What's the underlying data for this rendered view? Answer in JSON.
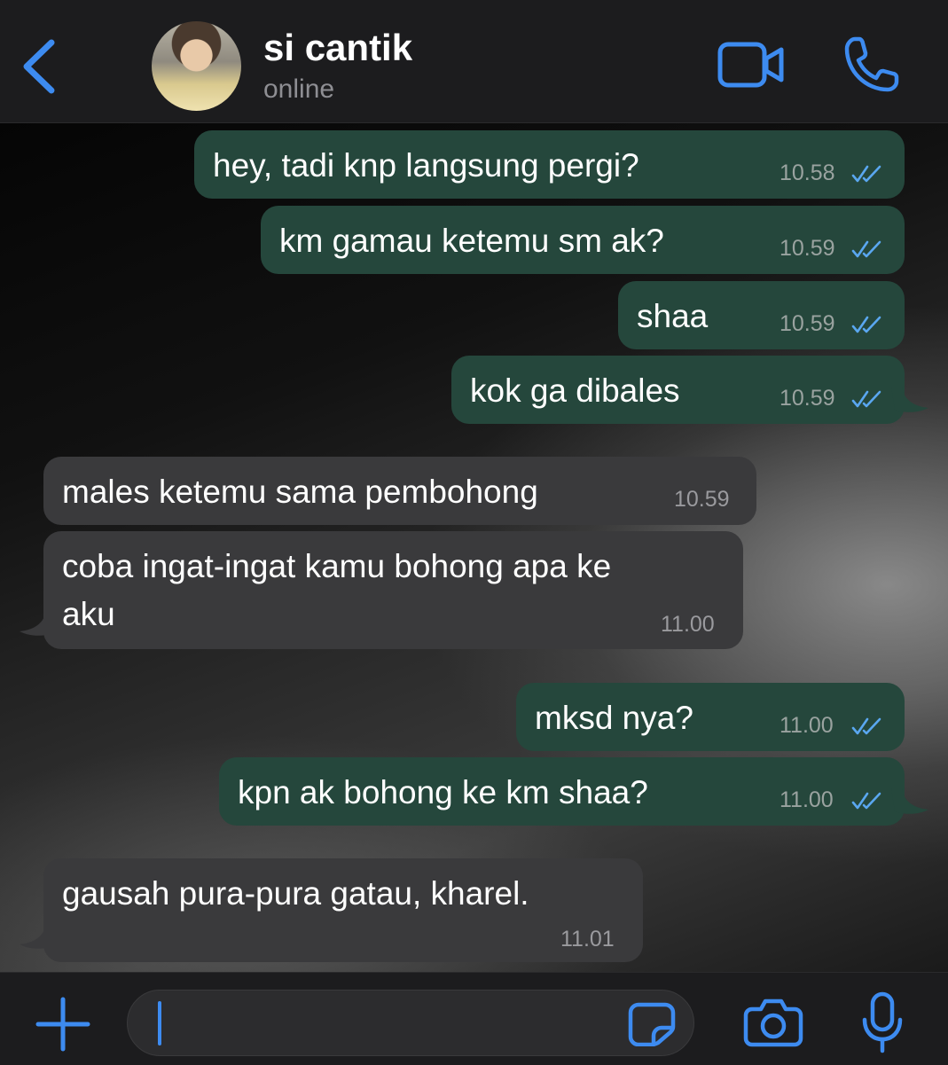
{
  "header": {
    "contact_name": "si cantik",
    "status": "online",
    "back_icon": "chevron-left-icon",
    "video_icon": "video-camera-icon",
    "call_icon": "phone-icon",
    "accent_color": "#3d8bf0"
  },
  "messages": [
    {
      "direction": "out",
      "text": "hey, tadi knp langsung pergi?",
      "time": "10.58",
      "status": "read"
    },
    {
      "direction": "out",
      "text": "km gamau ketemu sm ak?",
      "time": "10.59",
      "status": "read"
    },
    {
      "direction": "out",
      "text": "shaa",
      "time": "10.59",
      "status": "read"
    },
    {
      "direction": "out",
      "text": "kok ga dibales",
      "time": "10.59",
      "status": "read"
    },
    {
      "direction": "in",
      "text": "males ketemu sama pembohong",
      "time": "10.59"
    },
    {
      "direction": "in",
      "text_line1": "coba ingat-ingat kamu bohong apa ke",
      "text_line2": "aku",
      "time": "11.00"
    },
    {
      "direction": "out",
      "text": "mksd nya?",
      "time": "11.00",
      "status": "read"
    },
    {
      "direction": "out",
      "text": "kpn ak bohong ke km shaa?",
      "time": "11.00",
      "status": "read"
    },
    {
      "direction": "in",
      "text": "gausah pura-pura gatau, kharel.",
      "time": "11.01"
    }
  ],
  "colors": {
    "outgoing_bubble": "#25473c",
    "incoming_bubble": "#3a3a3c",
    "read_ticks": "#5aa7f0"
  },
  "input_bar": {
    "message_value": "",
    "plus_icon": "plus-icon",
    "sticker_icon": "sticker-icon",
    "camera_icon": "camera-icon",
    "mic_icon": "microphone-icon"
  }
}
